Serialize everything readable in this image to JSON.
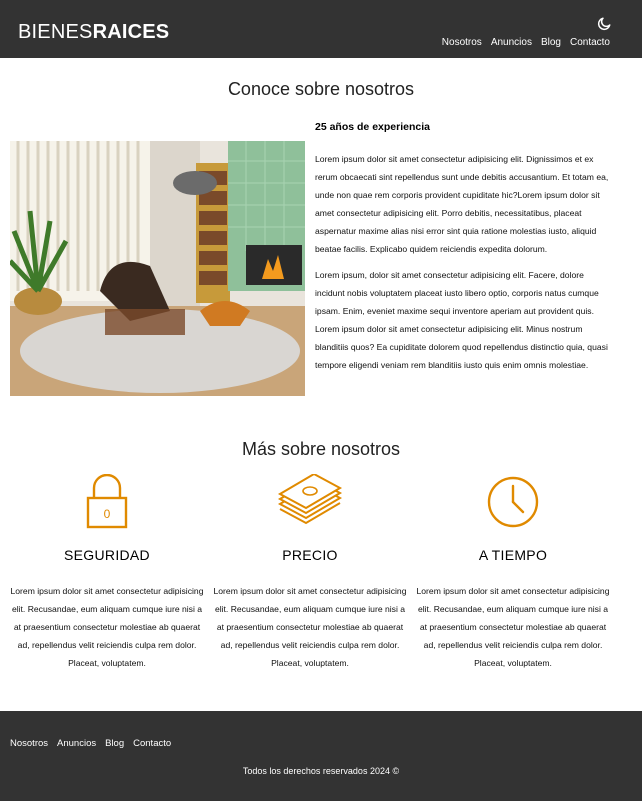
{
  "header": {
    "logo_part1": "BIENES",
    "logo_part2": "RAICES",
    "nav": [
      "Nosotros",
      "Anuncios",
      "Blog",
      "Contacto"
    ]
  },
  "about": {
    "title": "Conoce sobre nosotros",
    "heading": "25 años de experiencia",
    "paragraph1": "Lorem ipsum dolor sit amet consectetur adipisicing elit. Dignissimos et ex rerum obcaecati sint repellendus sunt unde debitis accusantium. Et totam ea, unde non quae rem corporis provident cupiditate hic?Lorem ipsum dolor sit amet consectetur adipisicing elit. Porro debitis, necessitatibus, placeat aspernatur maxime alias nisi error sint quia ratione molestias iusto, aliquid beatae facilis. Explicabo quidem reiciendis expedita dolorum.",
    "paragraph2": "Lorem ipsum, dolor sit amet consectetur adipisicing elit. Facere, dolore incidunt nobis voluptatem placeat iusto libero optio, corporis natus cumque ipsam. Enim, eveniet maxime sequi inventore aperiam aut provident quis. Lorem ipsum dolor sit amet consectetur adipisicing elit. Minus nostrum blanditiis quos? Ea cupiditate dolorem quod repellendus distinctio quia, quasi tempore eligendi veniam rem blanditiis iusto quis enim omnis molestiae."
  },
  "more": {
    "title": "Más sobre nosotros",
    "features": [
      {
        "icon": "lock-icon",
        "title": "SEGURIDAD",
        "text": "Lorem ipsum dolor sit amet consectetur adipisicing elit. Recusandae, eum aliquam cumque iure nisi a at praesentium consectetur molestiae ab quaerat ad, repellendus velit reiciendis culpa rem dolor. Placeat, voluptatem."
      },
      {
        "icon": "money-icon",
        "title": "PRECIO",
        "text": "Lorem ipsum dolor sit amet consectetur adipisicing elit. Recusandae, eum aliquam cumque iure nisi a at praesentium consectetur molestiae ab quaerat ad, repellendus velit reiciendis culpa rem dolor. Placeat, voluptatem."
      },
      {
        "icon": "clock-icon",
        "title": "A TIEMPO",
        "text": "Lorem ipsum dolor sit amet consectetur adipisicing elit. Recusandae, eum aliquam cumque iure nisi a at praesentium consectetur molestiae ab quaerat ad, repellendus velit reiciendis culpa rem dolor. Placeat, voluptatem."
      }
    ]
  },
  "footer": {
    "nav": [
      "Nosotros",
      "Anuncios",
      "Blog",
      "Contacto"
    ],
    "copyright": "Todos los derechos reservados 2024 ©"
  },
  "colors": {
    "header_bg": "#333333",
    "accent": "#E08A00"
  }
}
